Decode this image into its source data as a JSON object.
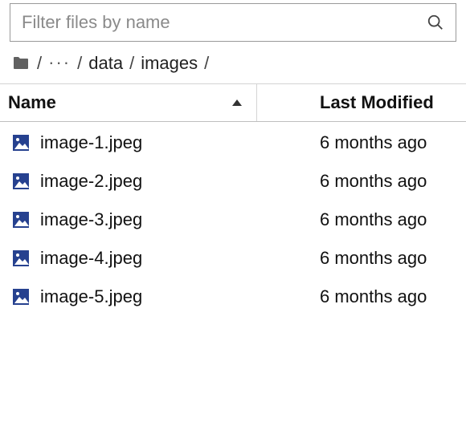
{
  "filter": {
    "placeholder": "Filter files by name"
  },
  "breadcrumb": {
    "ellipsis": "···",
    "sep": "/",
    "segments": [
      "data",
      "images"
    ]
  },
  "columns": {
    "name": "Name",
    "modified": "Last Modified"
  },
  "files": [
    {
      "name": "image-1.jpeg",
      "modified": "6 months ago"
    },
    {
      "name": "image-2.jpeg",
      "modified": "6 months ago"
    },
    {
      "name": "image-3.jpeg",
      "modified": "6 months ago"
    },
    {
      "name": "image-4.jpeg",
      "modified": "6 months ago"
    },
    {
      "name": "image-5.jpeg",
      "modified": "6 months ago"
    }
  ]
}
